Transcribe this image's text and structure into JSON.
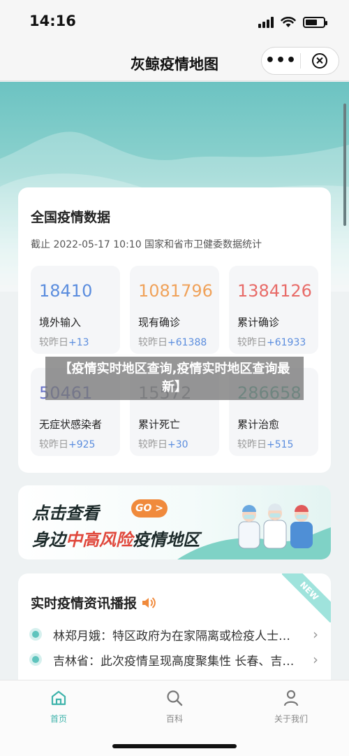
{
  "status_bar": {
    "time": "14:16"
  },
  "nav": {
    "title": "灰鲸疫情地图",
    "more_icon": "more-dots-icon",
    "close_icon": "close-circle-icon"
  },
  "stats": {
    "title": "全国疫情数据",
    "subtitle": "截止 2022-05-17 10:10 国家和省市卫健委数据统计",
    "compare_prefix": "较昨日",
    "items": [
      {
        "value": "18410",
        "label": "境外输入",
        "delta": "+13",
        "color": "#5b8dde"
      },
      {
        "value": "1081796",
        "label": "现有确诊",
        "delta": "+61388",
        "color": "#f0a25a"
      },
      {
        "value": "1384126",
        "label": "累计确诊",
        "delta": "+61933",
        "color": "#e86b68"
      },
      {
        "value": "50461",
        "label": "无症状感染者",
        "delta": "+925",
        "color": "#6a74c9"
      },
      {
        "value": "15572",
        "label": "累计死亡",
        "delta": "+30",
        "color": "#8a8f99"
      },
      {
        "value": "286658",
        "label": "累计治愈",
        "delta": "+515",
        "color": "#4fb39a"
      }
    ]
  },
  "overlay_title": "【疫情实时地区查询,疫情实时地区查询最新】",
  "banner": {
    "line1": "点击查看",
    "go_label": "GO >",
    "line2_prefix": "身边",
    "line2_highlight": "中高风险",
    "line2_suffix": "疫情地区"
  },
  "news": {
    "title": "实时疫情资讯播报",
    "badge": "NEW",
    "speaker_icon": "speaker-icon",
    "items": [
      "林郑月娥：特区政府为在家隔离或检疫人士提供支援",
      "吉林省：此次疫情呈现高度聚集性 长春、吉林两市"
    ]
  },
  "tabbar": {
    "tabs": [
      {
        "label": "首页",
        "icon": "home-icon",
        "active": true
      },
      {
        "label": "百科",
        "icon": "search-icon",
        "active": false
      },
      {
        "label": "关于我们",
        "icon": "person-icon",
        "active": false
      }
    ]
  },
  "colors": {
    "accent": "#3fb3ab",
    "delta_up": "#5b8dde"
  }
}
